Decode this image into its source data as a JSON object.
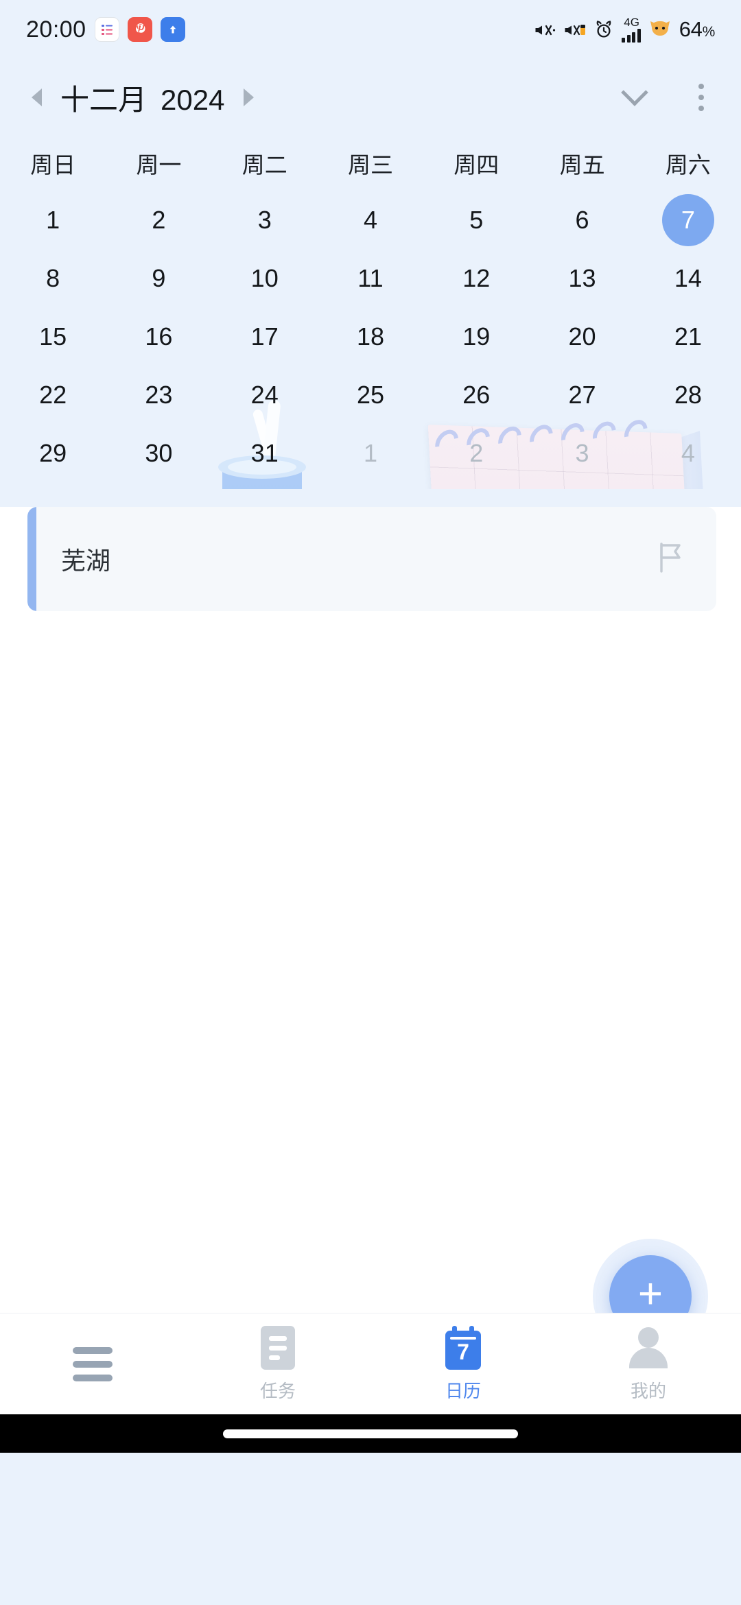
{
  "status_bar": {
    "time": "20:00",
    "battery": "64",
    "battery_unit": "%",
    "network_type": "4G",
    "left_icons": [
      "notes-app-icon",
      "pinterest-app-icon",
      "upload-arrow-icon"
    ],
    "right_icons": [
      "mute-icon",
      "vibrate-icon",
      "alarm-icon",
      "signal-icon",
      "cat-icon"
    ]
  },
  "header": {
    "month": "十二月",
    "year": "2024",
    "prev_icon": "prev-month-arrow-icon",
    "next_icon": "next-month-arrow-icon",
    "expand_icon": "chevron-down-icon",
    "menu_icon": "overflow-menu-icon"
  },
  "calendar": {
    "weekdays": [
      "周日",
      "周一",
      "周二",
      "周三",
      "周四",
      "周五",
      "周六"
    ],
    "selected_day": 7,
    "accent_color": "#7da9f0",
    "weeks": [
      [
        {
          "d": "1",
          "other": false
        },
        {
          "d": "2",
          "other": false
        },
        {
          "d": "3",
          "other": false
        },
        {
          "d": "4",
          "other": false
        },
        {
          "d": "5",
          "other": false
        },
        {
          "d": "6",
          "other": false
        },
        {
          "d": "7",
          "other": false,
          "selected": true
        }
      ],
      [
        {
          "d": "8",
          "other": false
        },
        {
          "d": "9",
          "other": false
        },
        {
          "d": "10",
          "other": false
        },
        {
          "d": "11",
          "other": false
        },
        {
          "d": "12",
          "other": false
        },
        {
          "d": "13",
          "other": false
        },
        {
          "d": "14",
          "other": false
        }
      ],
      [
        {
          "d": "15",
          "other": false
        },
        {
          "d": "16",
          "other": false
        },
        {
          "d": "17",
          "other": false
        },
        {
          "d": "18",
          "other": false
        },
        {
          "d": "19",
          "other": false
        },
        {
          "d": "20",
          "other": false
        },
        {
          "d": "21",
          "other": false
        }
      ],
      [
        {
          "d": "22",
          "other": false
        },
        {
          "d": "23",
          "other": false
        },
        {
          "d": "24",
          "other": false
        },
        {
          "d": "25",
          "other": false
        },
        {
          "d": "26",
          "other": false
        },
        {
          "d": "27",
          "other": false
        },
        {
          "d": "28",
          "other": false
        }
      ],
      [
        {
          "d": "29",
          "other": false
        },
        {
          "d": "30",
          "other": false
        },
        {
          "d": "31",
          "other": false
        },
        {
          "d": "1",
          "other": true
        },
        {
          "d": "2",
          "other": true
        },
        {
          "d": "3",
          "other": true
        },
        {
          "d": "4",
          "other": true
        }
      ]
    ]
  },
  "events": [
    {
      "title": "芜湖",
      "accent_color": "#93b6f0",
      "flag_icon": "flag-outline-icon"
    }
  ],
  "fab": {
    "label": "+",
    "icon": "add-event-icon",
    "color": "#82aaf2"
  },
  "bottom_nav": {
    "active": "日历",
    "active_color": "#4f87ed",
    "inactive_color": "#b5bcc4",
    "items": [
      {
        "label": "",
        "icon": "hamburger-menu-icon"
      },
      {
        "label": "任务",
        "icon": "tasks-icon"
      },
      {
        "label": "日历",
        "icon": "calendar-icon",
        "badge": "7"
      },
      {
        "label": "我的",
        "icon": "profile-icon"
      }
    ]
  }
}
